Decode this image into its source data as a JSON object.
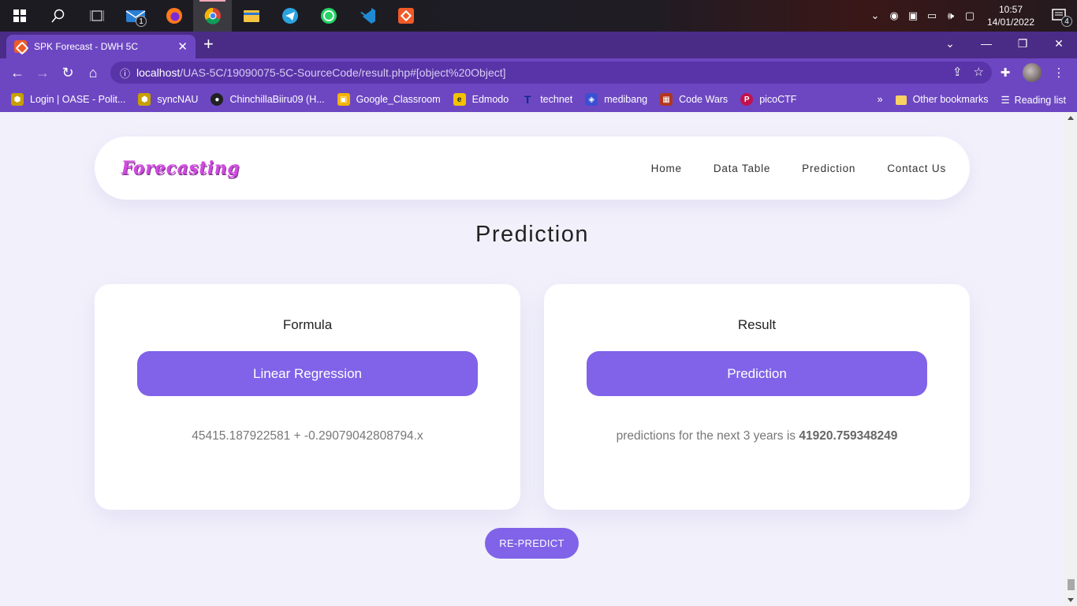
{
  "taskbar": {
    "mail_badge": "1",
    "clock_time": "10:57",
    "clock_date": "14/01/2022",
    "notification_count": "4"
  },
  "browser": {
    "tab_title": "SPK Forecast - DWH 5C",
    "url_host": "localhost",
    "url_path": "/UAS-5C/19090075-5C-SourceCode/result.php#[object%20Object]",
    "bookmarks": [
      {
        "label": "Login | OASE - Polit...",
        "color": "#c7a000",
        "glyph": "⬢"
      },
      {
        "label": "syncNAU",
        "color": "#c7a000",
        "glyph": "⬢"
      },
      {
        "label": "ChinchillaBiiru09 (H...",
        "color": "#222222",
        "glyph": "●"
      },
      {
        "label": "Google_Classroom",
        "color": "#f4b400",
        "glyph": "▣"
      },
      {
        "label": "Edmodo",
        "color": "#f2c200",
        "glyph": "e"
      },
      {
        "label": "technet",
        "color": "#0a2a8a",
        "glyph": "T"
      },
      {
        "label": "medibang",
        "color": "#3b4fd1",
        "glyph": "◈"
      },
      {
        "label": "Code Wars",
        "color": "#b1361e",
        "glyph": "▦"
      },
      {
        "label": "picoCTF",
        "color": "#c0134d",
        "glyph": "P"
      }
    ],
    "other_bookmarks": "Other bookmarks",
    "reading_list": "Reading list"
  },
  "site": {
    "logo": "Forecasting",
    "nav": [
      "Home",
      "Data Table",
      "Prediction",
      "Contact Us"
    ],
    "heading": "Prediction",
    "formula_card": {
      "title": "Formula",
      "button": "Linear Regression",
      "text": "45415.187922581 + -0.29079042808794.x"
    },
    "result_card": {
      "title": "Result",
      "button": "Prediction",
      "text_prefix": "predictions for the next 3 years is ",
      "value": "41920.759348249"
    },
    "repredict_button": "RE-PREDICT"
  },
  "colors": {
    "accent": "#8063e8",
    "browser_frame": "#6d47c2",
    "logo": "#d14be0",
    "page_bg": "#f2f1fb"
  }
}
